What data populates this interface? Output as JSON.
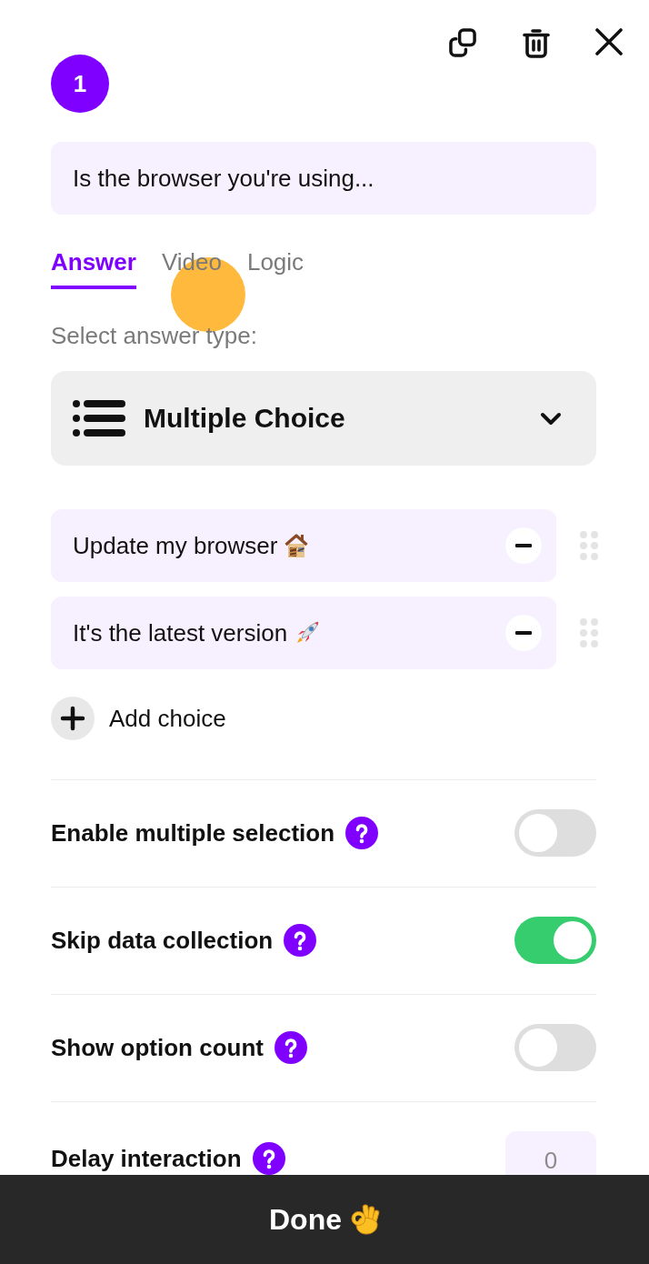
{
  "question": {
    "number": "1",
    "text": "Is the browser you're using..."
  },
  "tabs": [
    {
      "label": "Answer",
      "selected": true
    },
    {
      "label": "Video",
      "selected": false
    },
    {
      "label": "Logic",
      "selected": false
    }
  ],
  "answer_type": {
    "label": "Select answer type:",
    "value": "Multiple Choice"
  },
  "choices": [
    {
      "text": "Update my browser"
    },
    {
      "text": "It's the latest version"
    }
  ],
  "add_choice": {
    "label": "Add choice"
  },
  "settings": [
    {
      "kind": "toggle",
      "label": "Enable multiple selection",
      "on": false
    },
    {
      "kind": "toggle",
      "label": "Skip data collection",
      "on": true
    },
    {
      "kind": "toggle",
      "label": "Show option count",
      "on": false
    },
    {
      "kind": "number",
      "label": "Delay interaction",
      "placeholder": "0"
    }
  ],
  "done_button": {
    "label": "Done"
  }
}
